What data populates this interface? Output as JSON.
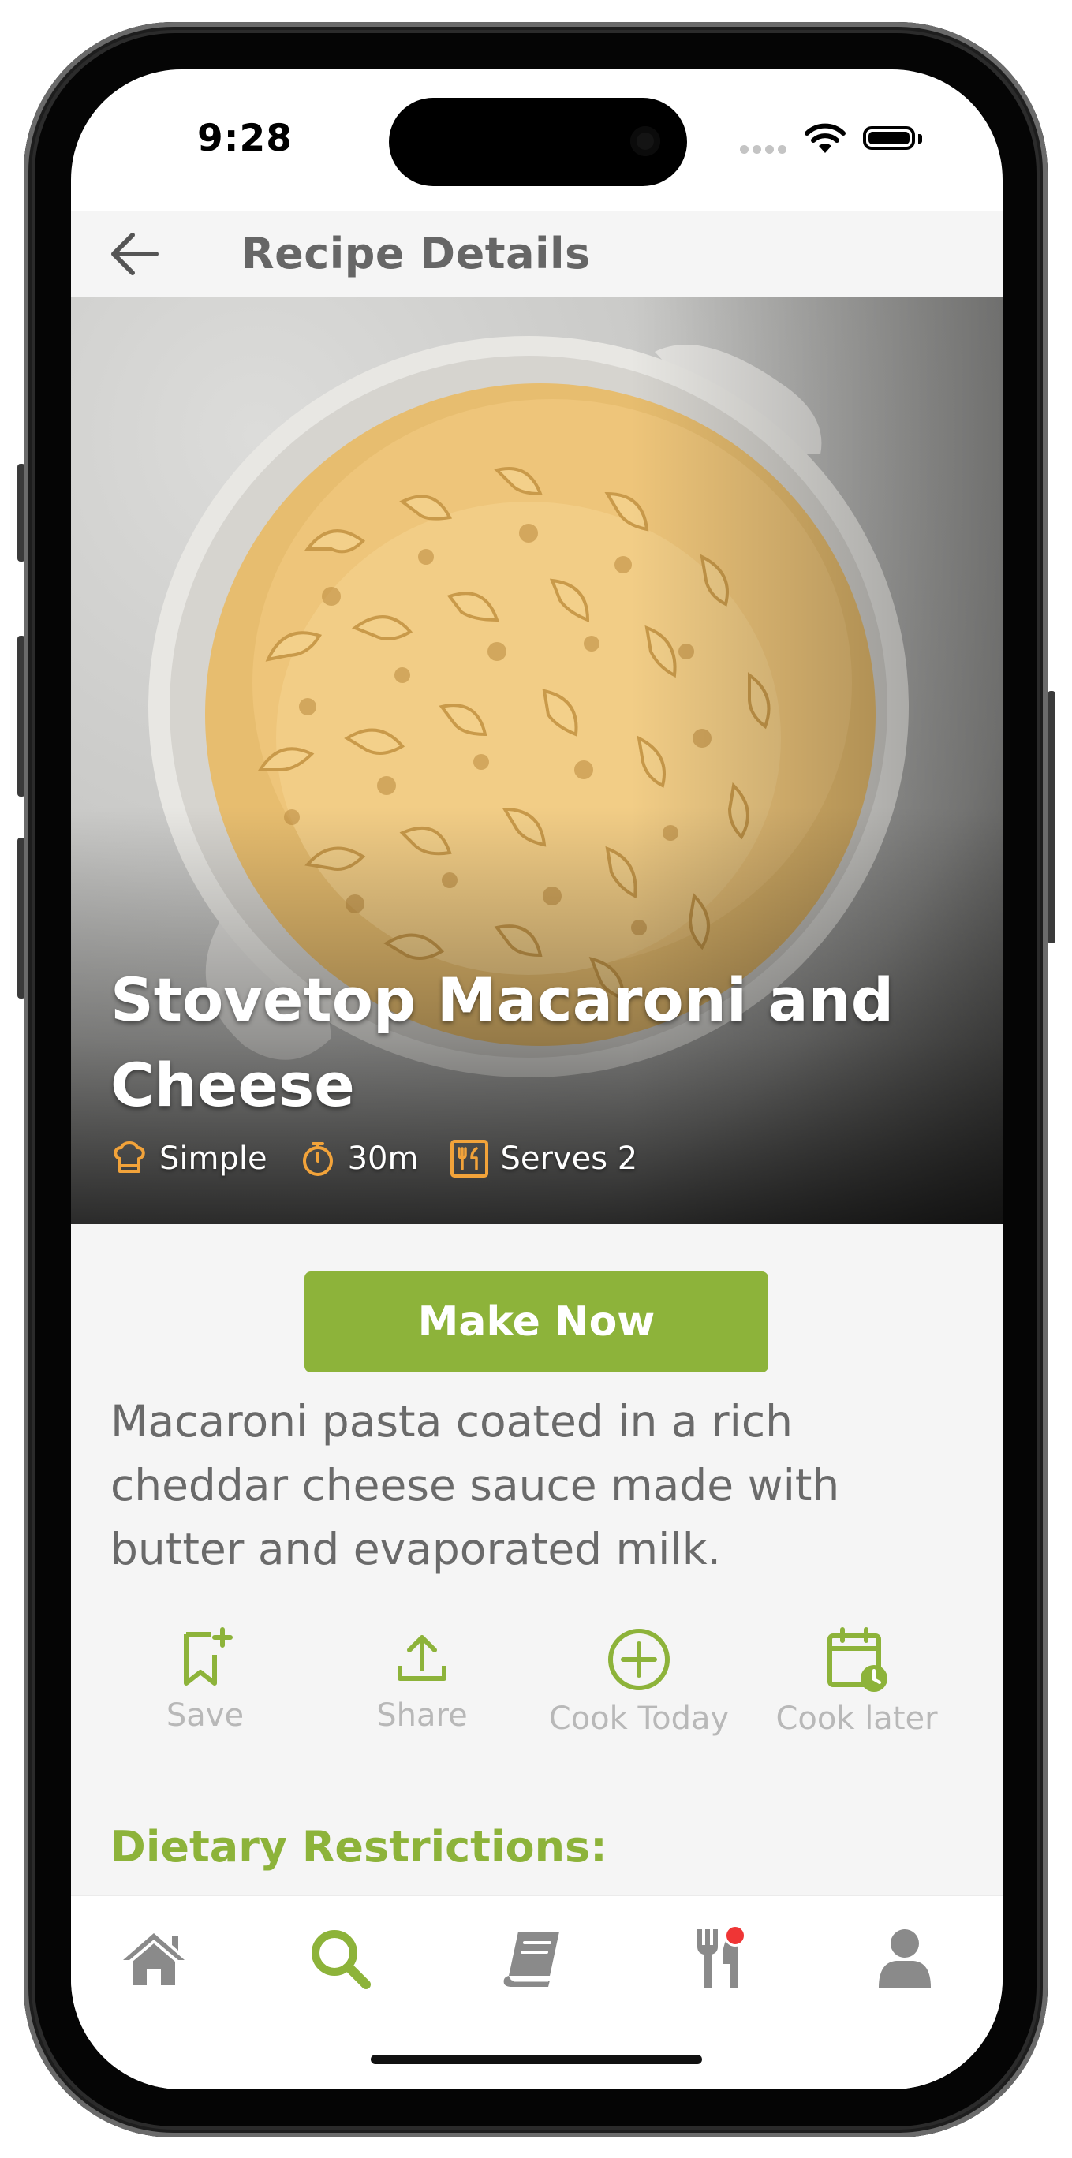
{
  "status_bar": {
    "time": "9:28"
  },
  "header": {
    "title": "Recipe Details",
    "back_icon": "arrow-left-icon"
  },
  "recipe": {
    "title": "Stovetop Macaroni and Cheese",
    "difficulty": "Simple",
    "time": "30m",
    "serves": "Serves 2",
    "image_subject": "macaroni and cheese in a white bowl"
  },
  "make_now_label": "Make Now",
  "description": "Macaroni pasta coated in a rich cheddar cheese sauce made with butter and evaporated milk.",
  "actions": [
    {
      "label": "Save",
      "icon": "bookmark-plus-icon"
    },
    {
      "label": "Share",
      "icon": "share-icon"
    },
    {
      "label": "Cook Today",
      "icon": "plus-circle-icon"
    },
    {
      "label": "Cook later",
      "icon": "calendar-clock-icon"
    }
  ],
  "section_dietary": "Dietary Restrictions:",
  "bottom_nav": [
    {
      "name": "home",
      "icon": "home-icon",
      "active": false
    },
    {
      "name": "search",
      "icon": "search-icon",
      "active": true
    },
    {
      "name": "recipes",
      "icon": "book-icon",
      "active": false
    },
    {
      "name": "meals",
      "icon": "utensils-icon",
      "active": false,
      "badge": true
    },
    {
      "name": "profile",
      "icon": "user-icon",
      "active": false
    }
  ],
  "colors": {
    "accent": "#8db33a",
    "meta_icon": "#f2a33a",
    "text_muted": "#6a6a6a",
    "nav_icon": "#8a8a8a",
    "badge": "#ef3535"
  }
}
